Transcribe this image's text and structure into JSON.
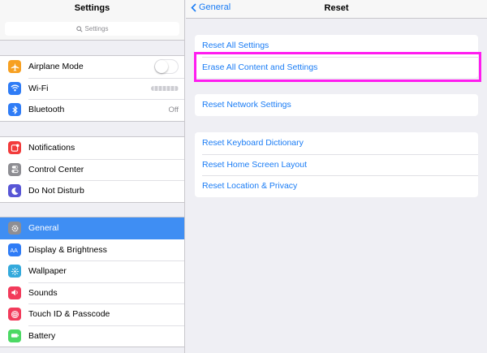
{
  "master": {
    "title": "Settings",
    "search_placeholder": "Settings",
    "groups": [
      [
        {
          "label": "Airplane Mode",
          "icon": "airplane-icon",
          "color": "#f7a021"
        },
        {
          "label": "Wi-Fi",
          "icon": "wifi-icon",
          "color": "#2f7cf6"
        },
        {
          "label": "Bluetooth",
          "value": "Off",
          "icon": "bluetooth-icon",
          "color": "#2f7cf6"
        }
      ],
      [
        {
          "label": "Notifications",
          "icon": "notifications-icon",
          "color": "#f23b3b"
        },
        {
          "label": "Control Center",
          "icon": "control-center-icon",
          "color": "#8e8e93"
        },
        {
          "label": "Do Not Disturb",
          "icon": "moon-icon",
          "color": "#5856d6"
        }
      ],
      [
        {
          "label": "General",
          "icon": "gear-icon",
          "color": "#8e8e93"
        },
        {
          "label": "Display & Brightness",
          "icon": "display-icon",
          "color": "#2f7cf6"
        },
        {
          "label": "Wallpaper",
          "icon": "wallpaper-icon",
          "color": "#34aadc"
        },
        {
          "label": "Sounds",
          "icon": "sounds-icon",
          "color": "#f23b5b"
        },
        {
          "label": "Touch ID & Passcode",
          "icon": "fingerprint-icon",
          "color": "#f23b5b"
        },
        {
          "label": "Battery",
          "icon": "battery-icon",
          "color": "#4cd964"
        }
      ]
    ],
    "selected": "General",
    "airplane_mode_on": false
  },
  "detail": {
    "back_label": "General",
    "title": "Reset",
    "groups": [
      [
        "Reset All Settings",
        "Erase All Content and Settings"
      ],
      [
        "Reset Network Settings"
      ],
      [
        "Reset Keyboard Dictionary",
        "Reset Home Screen Layout",
        "Reset Location & Privacy"
      ]
    ]
  },
  "colors": {
    "accent": "#1a7cf5",
    "highlight": "#ff1cf0",
    "selected_row": "#3f8ef3"
  }
}
